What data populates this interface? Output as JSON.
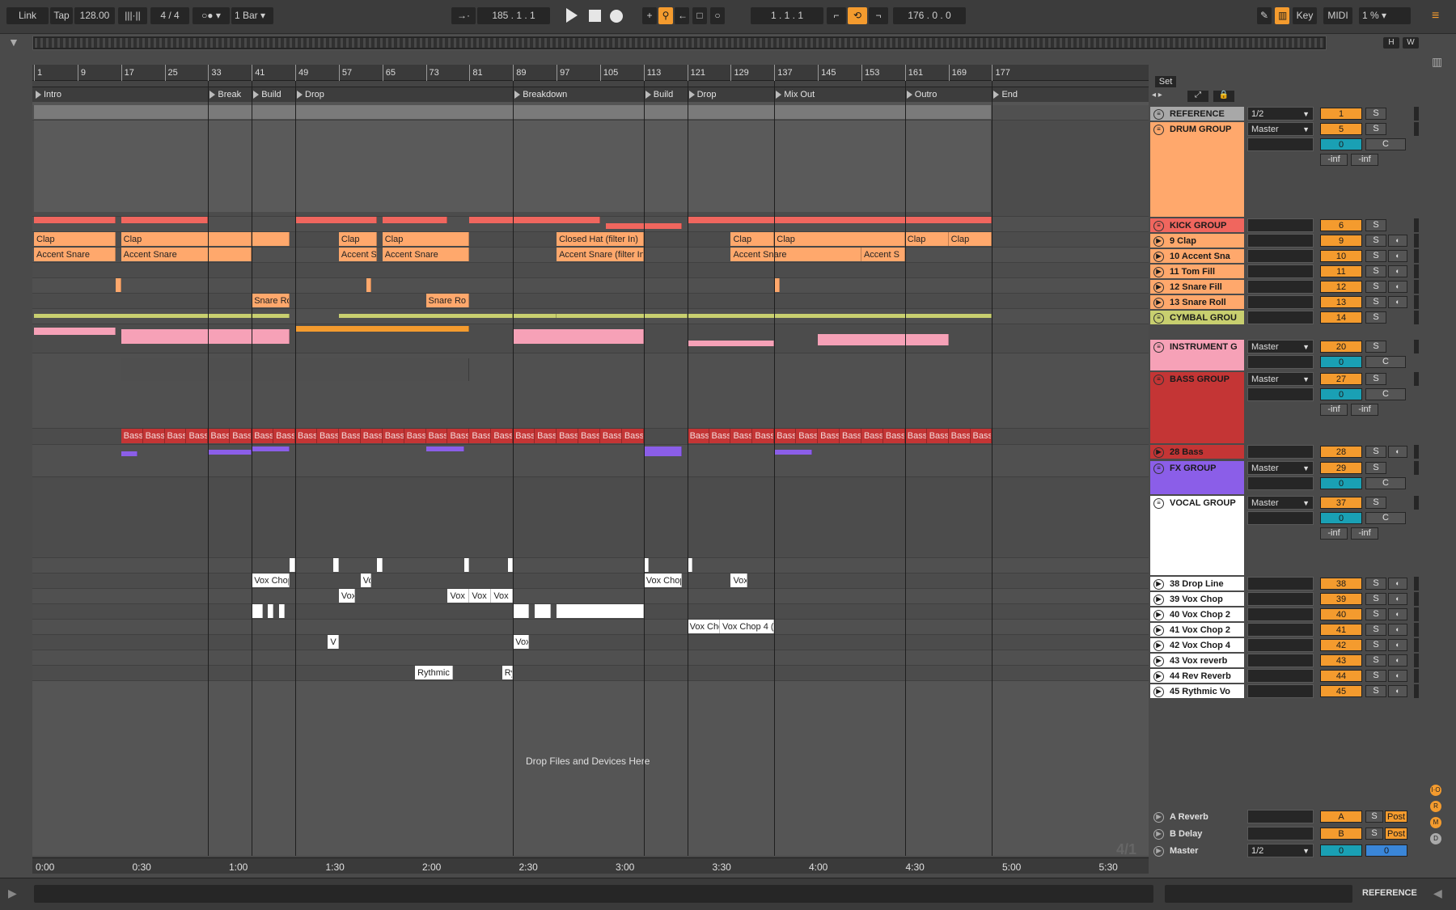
{
  "transport": {
    "link": "Link",
    "tap": "Tap",
    "tempo": "128.00",
    "signature": "4 / 4",
    "quantize": "1 Bar",
    "position": "185 .   1 .   1",
    "loop_start": "1 .   1 .   1",
    "loop_length": "176 .   0 .   0",
    "key_label": "Key",
    "midi_label": "MIDI",
    "cpu": "1 %"
  },
  "overview": {
    "h": "H",
    "w": "W"
  },
  "ruler": [
    "1",
    "9",
    "17",
    "25",
    "33",
    "41",
    "49",
    "57",
    "65",
    "73",
    "81",
    "89",
    "97",
    "105",
    "113",
    "121",
    "129",
    "137",
    "145",
    "153",
    "161",
    "169",
    "177"
  ],
  "locators": [
    "Intro",
    "Break",
    "Build",
    "Drop",
    "Breakdown",
    "Build",
    "Drop",
    "Mix Out",
    "Outro",
    "End"
  ],
  "set_label": "Set",
  "clips": {
    "clap": "Clap",
    "accent": "Accent Snare",
    "accent_short": "Accent S",
    "closed_hat": "Closed Hat  (filter In)",
    "accent_filter": "Accent Snare (filter In)",
    "snare_roll": "Snare Ro",
    "bass": "Bass",
    "vox_chop": "Vox Chop",
    "vox": "Vox",
    "vox_chop4": "Vox Chop 4 (f",
    "vox_cho": "Vox Cho",
    "rythmic": "Rythmic",
    "ry": "Ry",
    "v": "V",
    "vo": "Vo"
  },
  "drop_hint": "Drop Files and Devices Here",
  "tracks": [
    {
      "name": "REFERENCE",
      "io": "1/2",
      "num": "1",
      "color": "#a8a8a8"
    },
    {
      "name": "DRUM GROUP",
      "io": "Master",
      "num": "5",
      "vol": "0",
      "color": "#ffa86c"
    },
    {
      "name": "KICK GROUP",
      "num": "6",
      "color": "#f0665e"
    },
    {
      "name": "9 Clap",
      "num": "9",
      "color": "#ffa86c"
    },
    {
      "name": "10 Accent Sna",
      "num": "10",
      "color": "#ffa86c"
    },
    {
      "name": "11 Tom Fill",
      "num": "11",
      "color": "#ffa86c"
    },
    {
      "name": "12 Snare Fill",
      "num": "12",
      "color": "#ffa86c"
    },
    {
      "name": "13 Snare Roll",
      "num": "13",
      "color": "#ffa86c"
    },
    {
      "name": "CYMBAL GROU",
      "num": "14",
      "color": "#c8cf6f"
    },
    {
      "name": "INSTRUMENT G",
      "io": "Master",
      "num": "20",
      "vol": "0",
      "color": "#f6a1b7"
    },
    {
      "name": "BASS GROUP",
      "io": "Master",
      "num": "27",
      "vol": "0",
      "color": "#c43535"
    },
    {
      "name": "28 Bass",
      "num": "28",
      "color": "#c43535"
    },
    {
      "name": "FX GROUP",
      "io": "Master",
      "num": "29",
      "vol": "0",
      "color": "#8b5ee8"
    },
    {
      "name": "VOCAL GROUP",
      "io": "Master",
      "num": "37",
      "vol": "0",
      "color": "#ffffff"
    },
    {
      "name": "38 Drop Line",
      "num": "38",
      "color": "#ffffff"
    },
    {
      "name": "39 Vox Chop",
      "num": "39",
      "color": "#ffffff"
    },
    {
      "name": "40 Vox Chop 2",
      "num": "40",
      "color": "#ffffff"
    },
    {
      "name": "41 Vox Chop 2",
      "num": "41",
      "color": "#ffffff"
    },
    {
      "name": "42 Vox Chop 4",
      "num": "42",
      "color": "#ffffff"
    },
    {
      "name": "43 Vox reverb",
      "num": "43",
      "color": "#ffffff"
    },
    {
      "name": "44 Rev Reverb",
      "num": "44",
      "color": "#ffffff"
    },
    {
      "name": "45 Rythmic Vo",
      "num": "45",
      "color": "#ffffff"
    }
  ],
  "returns": [
    {
      "name": "A Reverb",
      "num": "A",
      "post": "Post"
    },
    {
      "name": "B Delay",
      "num": "B",
      "post": "Post"
    },
    {
      "name": "Master",
      "io": "1/2",
      "num": "0",
      "num2": "0"
    }
  ],
  "labels": {
    "s": "S",
    "c": "C",
    "inf": "-inf",
    "sig_display": "4/1"
  },
  "times": [
    "0:00",
    "0:30",
    "1:00",
    "1:30",
    "2:00",
    "2:30",
    "3:00",
    "3:30",
    "4:00",
    "4:30",
    "5:00",
    "5:30"
  ],
  "bottom": {
    "reference": "REFERENCE"
  }
}
